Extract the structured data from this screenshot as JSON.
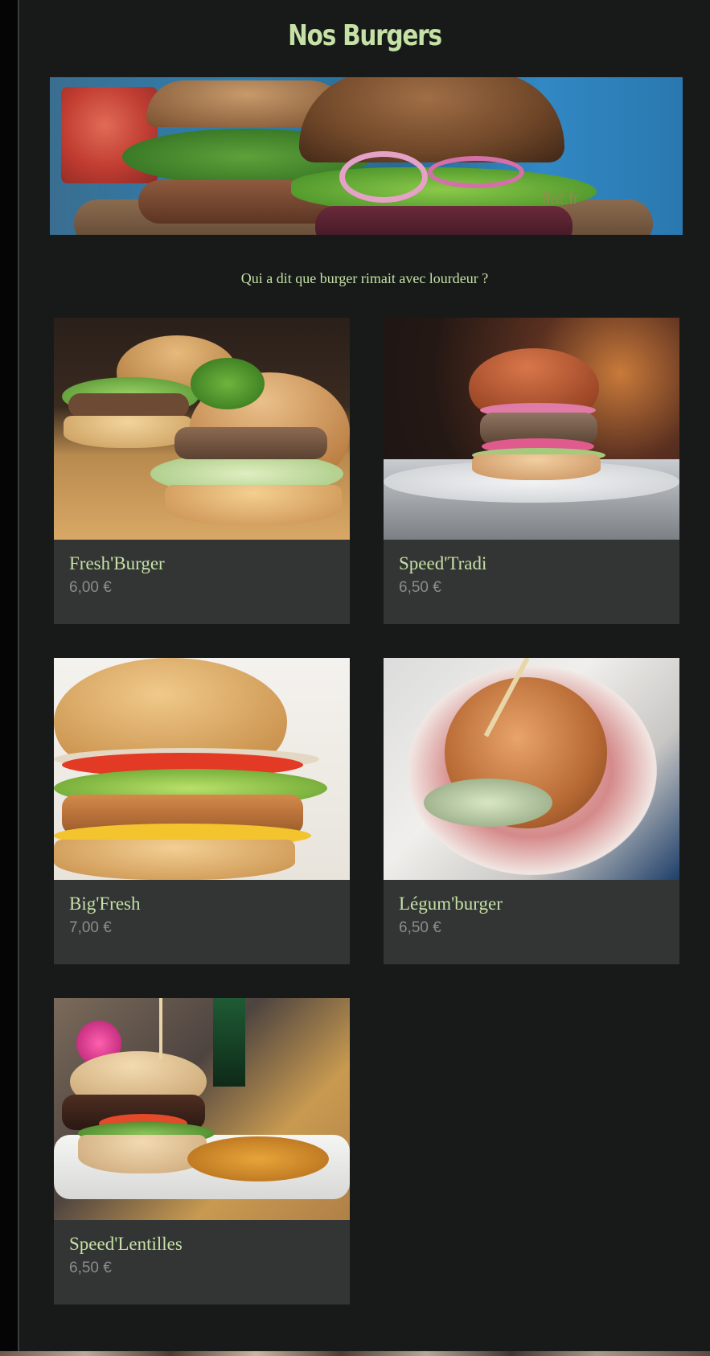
{
  "page": {
    "title": "Nos Burgers",
    "tagline": "Qui a dit que burger rimait avec lourdeur ?"
  },
  "hero": {
    "image": "burger-banner-photo",
    "watermark": "flat.fr"
  },
  "burgers": [
    {
      "name": "Fresh'Burger",
      "price": "6,00 €",
      "image": "two-burgers-basil-wooden-board"
    },
    {
      "name": "Speed'Tradi",
      "price": "6,50 €",
      "image": "burger-pink-onion-plate-bokeh"
    },
    {
      "name": "Big'Fresh",
      "price": "7,00 €",
      "image": "big-burger-lettuce-cheese-tomato"
    },
    {
      "name": "Légum'burger",
      "price": "6,50 €",
      "image": "sesame-burger-paper-basket"
    },
    {
      "name": "Speed'Lentilles",
      "price": "6,50 €",
      "image": "burger-with-fries-white-plate"
    }
  ],
  "colors": {
    "background": "#181a1a",
    "card": "#333434",
    "accent_text": "#c5e1a5",
    "price_text": "#8c8c8c"
  }
}
